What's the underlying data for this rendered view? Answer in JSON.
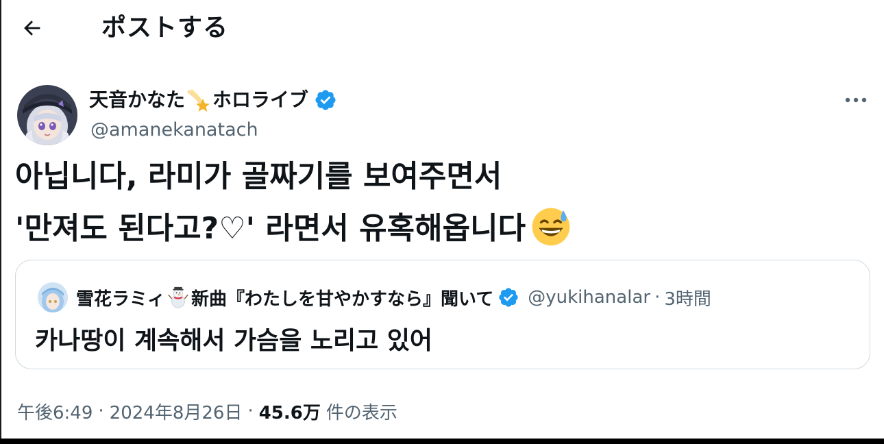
{
  "header": {
    "back_icon": "arrow-left-icon",
    "title": "ポストする"
  },
  "author": {
    "name_part1": "天音かなた",
    "name_emoji": "shooting-star-emoji",
    "name_part2": "ホロライブ",
    "verified_icon": "verified-badge-icon",
    "handle": "@amanekanatach",
    "more_icon": "more-dots-icon"
  },
  "post": {
    "line1": "아닙니다, 라미가 골짜기를 보여주면서",
    "line2": "'만져도 된다고?♡' 라면서 유혹해옵니다",
    "emoji": "grinning-sweat-emoji"
  },
  "quote": {
    "name_part1": "雪花ラミィ",
    "name_emoji": "snowman-emoji",
    "name_part2": "新曲『わたしを甘やかすなら』聞いて",
    "verified_icon": "verified-badge-icon",
    "handle": "@yukihanalar",
    "dot": "·",
    "time": "3時間",
    "text": "카나땅이 계속해서 가슴을 노리고 있어"
  },
  "meta": {
    "time": "午後6:49",
    "dot1": "·",
    "date": "2024年8月26日",
    "dot2": "·",
    "views": "45.6万",
    "views_label": "件の表示"
  },
  "colors": {
    "text_primary": "#0f1419",
    "text_secondary": "#536471",
    "verified_blue": "#1d9bf0",
    "border": "#cfd9de"
  }
}
